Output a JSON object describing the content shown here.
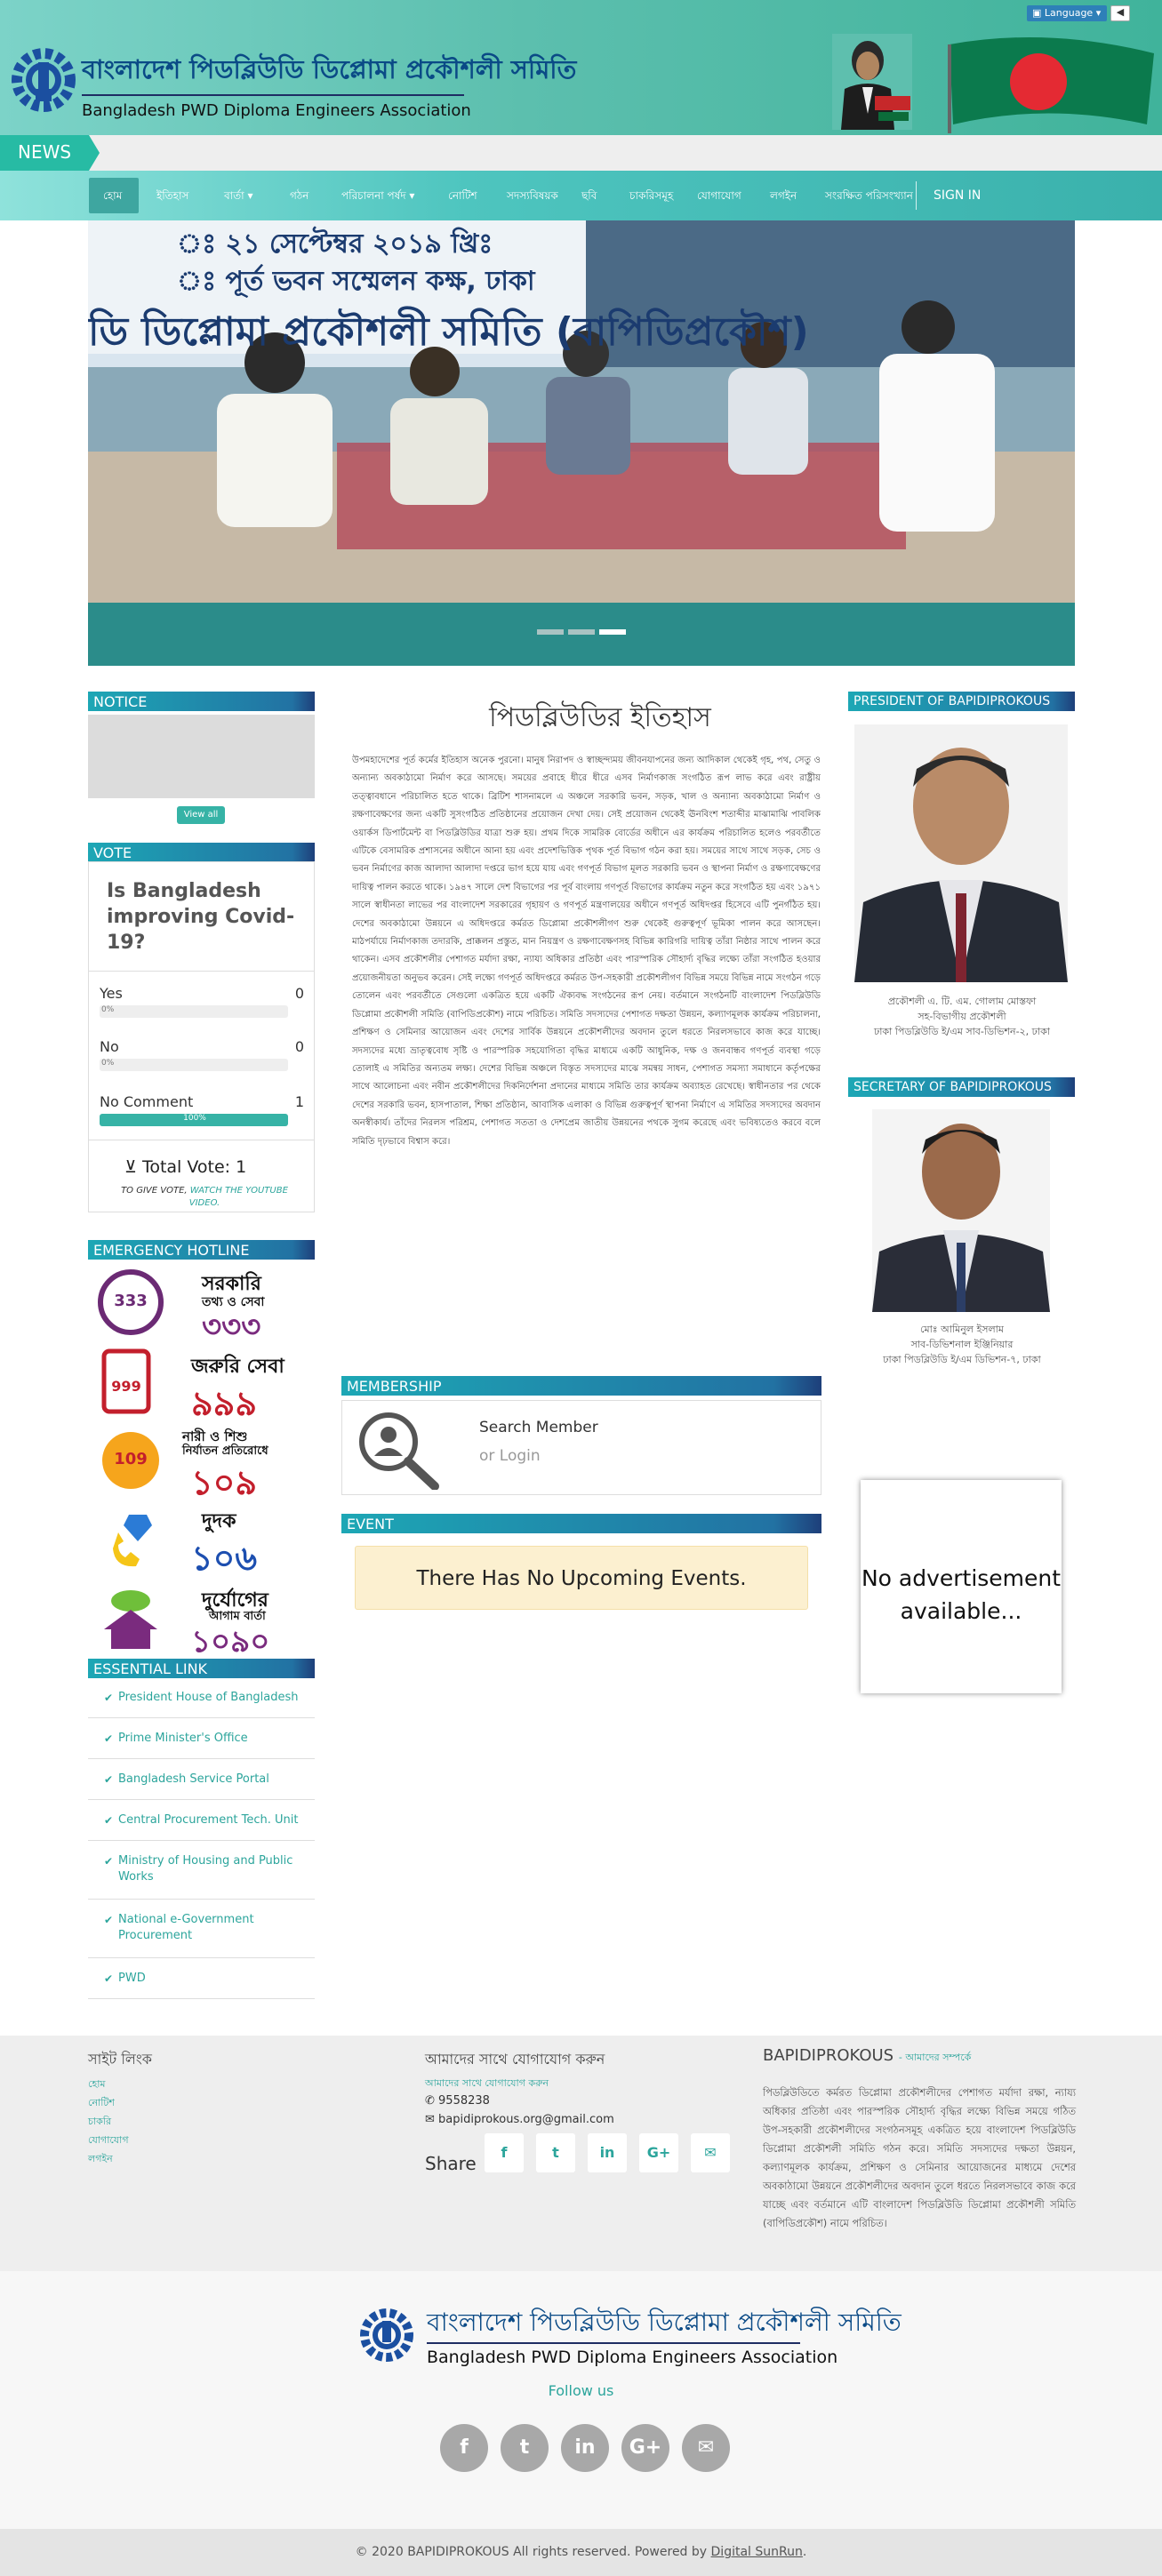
{
  "header": {
    "title_bn": "বাংলাদেশ পিডব্লিউডি ডিপ্লোমা প্রকৌশলী সমিতি",
    "title_en": "Bangladesh PWD Diploma Engineers Association",
    "language_label": "Language",
    "language_arrow": "▾",
    "sound_icon": "speaker-icon"
  },
  "news": {
    "label": "NEWS"
  },
  "nav": {
    "items": [
      "হোম",
      "ইতিহাস",
      "বার্তা ▾",
      "গঠন",
      "পরিচালনা পর্ষদ ▾",
      "নোটিশ",
      "সদস্যবিষয়ক",
      "ছবি",
      "চাকরিসমূহ",
      "যোগাযোগ",
      "লগইন",
      "সংরক্ষিত পরিসংখ্যান"
    ],
    "signin": "SIGN IN"
  },
  "slider": {
    "banner_line1": "ঃ ২১ সেপ্টেম্বর ২০১৯ খ্রিঃ",
    "banner_line2": "ঃ পূর্ত ভবন সম্মেলন কক্ষ, ঢাকা",
    "banner_line3": "ডি ডিপ্লোমা প্রকৌশলী সমিতি (বাপিডিপ্রকৌশ)",
    "dot_count": 3,
    "active_dot": 3
  },
  "notice": {
    "header": "NOTICE",
    "view_all": "View all"
  },
  "vote": {
    "header": "VOTE",
    "question": "Is Bangladesh improving Covid-19?",
    "options": [
      {
        "label": "Yes",
        "count": "0",
        "percent": "0%"
      },
      {
        "label": "No",
        "count": "0",
        "percent": "0%"
      },
      {
        "label": "No Comment",
        "count": "1",
        "percent": "100%"
      }
    ],
    "total": "Total Vote: 1",
    "hint_prefix": "TO GIVE VOTE,",
    "hint_link": "WATCH THE YOUTUBE VIDEO."
  },
  "hotline": {
    "header": "EMERGENCY HOTLINE",
    "items": [
      {
        "title": "সরকারি",
        "sub": "তথ্য ও সেবা",
        "number": "৩৩৩",
        "badge": "333"
      },
      {
        "title": "জরুরি সেবা",
        "sub": "",
        "number": "৯৯৯",
        "badge": "999"
      },
      {
        "title": "নারী ও শিশু",
        "sub": "নির্যাতন প্রতিরোধে",
        "number": "১০৯",
        "badge": "109"
      },
      {
        "title": "দুদক",
        "sub": "",
        "number": "১০৬",
        "badge": ""
      },
      {
        "title": "দুর্যোগের",
        "sub": "আগাম বার্তা",
        "number": "১০৯০",
        "badge": ""
      }
    ]
  },
  "essential": {
    "header": "ESSENTIAL LINK",
    "links": [
      "President House of Bangladesh",
      "Prime Minister's Office",
      "Bangladesh Service Portal",
      "Central Procurement Tech. Unit",
      "Ministry of Housing and Public Works",
      "National e-Government Procurement",
      "PWD"
    ]
  },
  "article": {
    "title": "পিডব্লিউডির ইতিহাস",
    "body": "উপমহাদেশের পূর্ত কর্মের ইতিহাস অনেক পুরনো। মানুষ নিরাপদ ও স্বাচ্ছন্দ্যময় জীবনযাপনের জন্য আদিকাল থেকেই গৃহ, পথ, সেতু ও অন্যান্য অবকাঠামো নির্মাণ করে আসছে। সময়ের প্রবাহে ধীরে ধীরে এসব নির্মাণকাজ সংগঠিত রূপ লাভ করে এবং রাষ্ট্রীয় তত্ত্বাবধানে পরিচালিত হতে থাকে। ব্রিটিশ শাসনামলে এ অঞ্চলে সরকারি ভবন, সড়ক, খাল ও অন্যান্য অবকাঠামো নির্মাণ ও রক্ষণাবেক্ষণের জন্য একটি সুসংগঠিত প্রতিষ্ঠানের প্রয়োজন দেখা দেয়। সেই প্রয়োজন থেকেই ঊনবিংশ শতাব্দীর মাঝামাঝি পাবলিক ওয়ার্কস ডিপার্টমেন্ট বা পিডব্লিউডির যাত্রা শুরু হয়। প্রথম দিকে সামরিক বোর্ডের অধীনে এর কার্যক্রম পরিচালিত হলেও পরবর্তীতে এটিকে বেসামরিক প্রশাসনের অধীনে আনা হয় এবং প্রদেশভিত্তিক পৃথক পূর্ত বিভাগ গঠন করা হয়। সময়ের সাথে সাথে সড়ক, সেচ ও ভবন নির্মাণের কাজ আলাদা আলাদা দপ্তরে ভাগ হয়ে যায় এবং গণপূর্ত বিভাগ মূলত সরকারি ভবন ও স্থাপনা নির্মাণ ও রক্ষণাবেক্ষণের দায়িত্ব পালন করতে থাকে। ১৯৪৭ সালে দেশ বিভাগের পর পূর্ব বাংলায় গণপূর্ত বিভাগের কার্যক্রম নতুন করে সংগঠিত হয় এবং ১৯৭১ সালে স্বাধীনতা লাভের পর বাংলাদেশ সরকারের গৃহায়ণ ও গণপূর্ত মন্ত্রণালয়ের অধীনে গণপূর্ত অধিদপ্তর হিসেবে এটি পুনর্গঠিত হয়। দেশের অবকাঠামো উন্নয়নে এ অধিদপ্তরে কর্মরত ডিপ্লোমা প্রকৌশলীগণ শুরু থেকেই গুরুত্বপূর্ণ ভূমিকা পালন করে আসছেন। মাঠপর্যায়ে নির্মাণকাজ তদারকি, প্রাক্কলন প্রস্তুত, মান নিয়ন্ত্রণ ও রক্ষণাবেক্ষণসহ বিভিন্ন কারিগরি দায়িত্ব তাঁরা নিষ্ঠার সাথে পালন করে থাকেন। এসব প্রকৌশলীর পেশাগত মর্যাদা রক্ষা, ন্যায্য অধিকার প্রতিষ্ঠা এবং পারস্পরিক সৌহার্দ্য বৃদ্ধির লক্ষ্যে তাঁরা সংগঠিত হওয়ার প্রয়োজনীয়তা অনুভব করেন। সেই লক্ষ্যে গণপূর্ত অধিদপ্তরে কর্মরত উপ-সহকারী প্রকৌশলীগণ বিভিন্ন সময়ে বিভিন্ন নামে সংগঠন গড়ে তোলেন এবং পরবর্তীতে সেগুলো একত্রিত হয়ে একটি ঐক্যবদ্ধ সংগঠনের রূপ নেয়। বর্তমানে সংগঠনটি বাংলাদেশ পিডব্লিউডি ডিপ্লোমা প্রকৌশলী সমিতি (বাপিডিপ্রকৌশ) নামে পরিচিত। সমিতি সদস্যদের পেশাগত দক্ষতা উন্নয়ন, কল্যাণমূলক কার্যক্রম পরিচালনা, প্রশিক্ষণ ও সেমিনার আয়োজন এবং দেশের সার্বিক উন্নয়নে প্রকৌশলীদের অবদান তুলে ধরতে নিরলসভাবে কাজ করে যাচ্ছে। সদস্যদের মধ্যে ভ্রাতৃত্ববোধ সৃষ্টি ও পারস্পরিক সহযোগিতা বৃদ্ধির মাধ্যমে একটি আধুনিক, দক্ষ ও জনবান্ধব গণপূর্ত ব্যবস্থা গড়ে তোলাই এ সমিতির অন্যতম লক্ষ্য। দেশের বিভিন্ন অঞ্চলে বিস্তৃত সদস্যদের মাঝে সমন্বয় সাধন, পেশাগত সমস্যা সমাধানে কর্তৃপক্ষের সাথে আলোচনা এবং নবীন প্রকৌশলীদের দিকনির্দেশনা প্রদানের মাধ্যমে সমিতি তার কার্যক্রম অব্যাহত রেখেছে। স্বাধীনতার পর থেকে দেশের সরকারি ভবন, হাসপাতাল, শিক্ষা প্রতিষ্ঠান, আবাসিক এলাকা ও বিভিন্ন গুরুত্বপূর্ণ স্থাপনা নির্মাণে এ সমিতির সদস্যদের অবদান অনস্বীকার্য। তাঁদের নিরলস পরিশ্রম, পেশাগত সততা ও দেশপ্রেম জাতীয় উন্নয়নের পথকে সুগম করেছে এবং ভবিষ্যতেও করবে বলে সমিতি দৃঢ়ভাবে বিশ্বাস করে।"
  },
  "membership": {
    "header": "MEMBERSHIP",
    "search": "Search Member",
    "login": "or Login"
  },
  "event": {
    "header": "EVENT",
    "message": "There Has No Upcoming Events."
  },
  "president": {
    "header": "PRESIDENT OF BAPIDIPROKOUS",
    "name": "প্রকৌশলী এ. টি. এম. গোলাম মোস্তফা",
    "role": "সহ-বিভাগীয় প্রকৌশলী",
    "office": "ঢাকা পিডব্লিউডি ই/এম সাব-ডিভিশন-২, ঢাকা"
  },
  "secretary": {
    "header": "SECRETARY OF BAPIDIPROKOUS",
    "name": "মোঃ আমিনুল ইসলাম",
    "role": "সাব-ডিভিশনাল ইঞ্জিনিয়ার",
    "office": "ঢাকা পিডব্লিউডি ই/এম ডিভিশন-৭, ঢাকা"
  },
  "ad": {
    "text": "No advertisement available..."
  },
  "footer": {
    "site_links_header": "সাইট লিংক",
    "site_links": [
      "হোম",
      "নোটিশ",
      "চাকরি",
      "যোগাযোগ",
      "লগইন"
    ],
    "contact_header": "আমাদের সাথে যোগাযোগ করুন",
    "contact_link": "আমাদের সাথে যোগাযোগ করুন",
    "phone": "9558238",
    "email": "bapidiprokous.org@gmail.com",
    "share_label": "Share",
    "share_buttons": [
      "f",
      "t",
      "in",
      "G+",
      "✉"
    ],
    "about_header": "BAPIDIPROKOUS",
    "about_sub": "- আমাদের সম্পর্কে",
    "about_text": "পিডব্লিউডিতে কর্মরত ডিপ্লোমা প্রকৌশলীদের পেশাগত মর্যাদা রক্ষা, ন্যায্য অধিকার প্রতিষ্ঠা এবং পারস্পরিক সৌহার্দ্য বৃদ্ধির লক্ষ্যে বিভিন্ন সময়ে গঠিত উপ-সহকারী প্রকৌশলীদের সংগঠনসমূহ একত্রিত হয়ে বাংলাদেশ পিডব্লিউডি ডিপ্লোমা প্রকৌশলী সমিতি গঠন করে। সমিতি সদস্যদের দক্ষতা উন্নয়ন, কল্যাণমূলক কার্যক্রম, প্রশিক্ষণ ও সেমিনার আয়োজনের মাধ্যমে দেশের অবকাঠামো উন্নয়নে প্রকৌশলীদের অবদান তুলে ধরতে নিরলসভাবে কাজ করে যাচ্ছে এবং বর্তমানে এটি বাংলাদেশ পিডব্লিউডি ডিপ্লোমা প্রকৌশলী সমিতি (বাপিডিপ্রকৌশ) নামে পরিচিত।"
  },
  "bottom": {
    "title_bn": "বাংলাদেশ পিডব্লিউডি ডিপ্লোমা প্রকৌশলী সমিতি",
    "title_en": "Bangladesh PWD Diploma Engineers Association",
    "follow": "Follow us",
    "socials": [
      "f",
      "t",
      "in",
      "G+",
      "✉"
    ],
    "copyright_prefix": "© 2020 BAPIDIPROKOUS All rights reserved. Powered by",
    "copyright_link": "Digital SunRun",
    "copyright_suffix": "."
  },
  "colors": {
    "accent": "#2ca59c",
    "header_dark": "#1e3f7a",
    "nav": "#3ab1ac"
  }
}
